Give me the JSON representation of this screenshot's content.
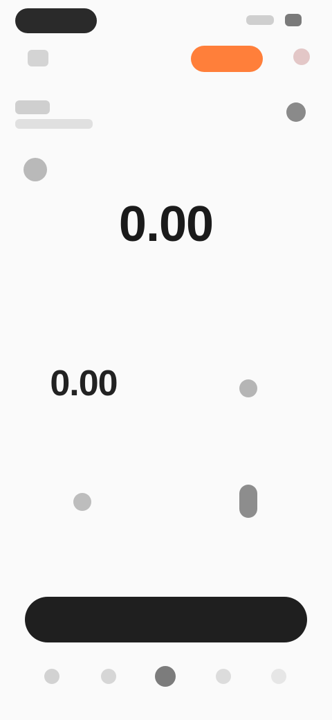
{
  "status_bar": {
    "time": "",
    "battery": ""
  },
  "header": {
    "greeting": "",
    "action_label": "",
    "title": "",
    "subtitle": ""
  },
  "stats": {
    "label_top": "",
    "main_value": "0.00",
    "main_unit": "",
    "left_value": "0.00",
    "left_label": "",
    "right_label": "",
    "bottom_left_label": "",
    "bottom_right_label": ""
  },
  "cta": {
    "label": ""
  },
  "nav": {
    "items": [
      "",
      "",
      "",
      "",
      ""
    ]
  },
  "colors": {
    "accent": "#ff7f3a",
    "dark": "#1f1f1f"
  }
}
